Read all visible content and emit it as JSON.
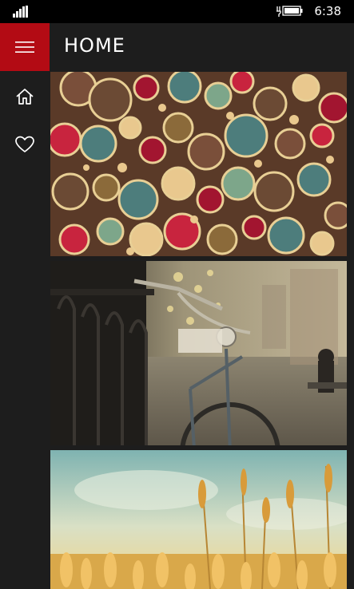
{
  "status_bar": {
    "signal_icon": "signal-icon",
    "battery_icon": "battery-charging-icon",
    "time": "6:38"
  },
  "header": {
    "title": "HOME",
    "menu_icon": "hamburger-menu-icon",
    "accent_color": "#b30b14"
  },
  "sidebar": {
    "items": [
      {
        "icon": "home-icon"
      },
      {
        "icon": "heart-icon"
      }
    ]
  },
  "gallery": {
    "photos": [
      {
        "subject": "circles-pattern"
      },
      {
        "subject": "bicycle"
      },
      {
        "subject": "wheat-field"
      }
    ]
  }
}
